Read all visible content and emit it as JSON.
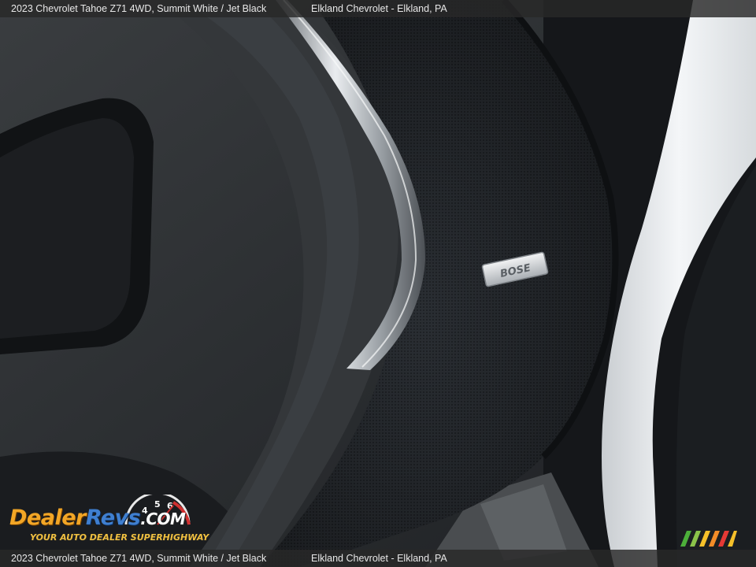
{
  "caption": {
    "vehicle": "2023 Chevrolet Tahoe Z71 4WD,  Summit White / Jet Black",
    "dealer": "Elkland Chevrolet - Elkland, PA"
  },
  "watermark": {
    "logo_dealer": "Dealer",
    "logo_revs": "Revs",
    "logo_com": ".COM",
    "tagline": "YOUR AUTO DEALER SUPERHIGHWAY",
    "gauge_digits": [
      "4",
      "5",
      "6"
    ]
  },
  "badge": {
    "text": "BOSE"
  },
  "colors": {
    "logo_orange": "#f2a626",
    "logo_blue": "#3f7fd0",
    "caption_bar": "#282828"
  }
}
